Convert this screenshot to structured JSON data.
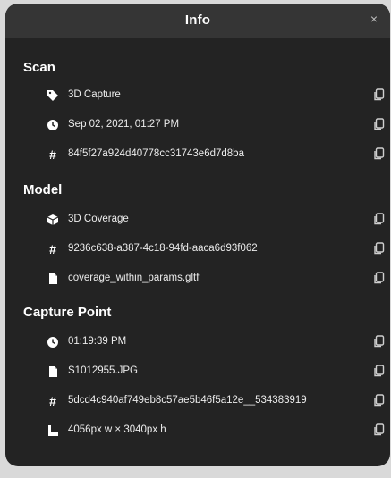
{
  "title": "Info",
  "close_glyph": "×",
  "sections": {
    "scan": {
      "title": "Scan",
      "rows": [
        {
          "icon": "tag-icon",
          "value": "3D Capture"
        },
        {
          "icon": "clock-icon",
          "value": "Sep 02, 2021, 01:27 PM"
        },
        {
          "icon": "hash-icon",
          "value": "84f5f27a924d40778cc31743e6d7d8ba"
        }
      ]
    },
    "model": {
      "title": "Model",
      "rows": [
        {
          "icon": "cube-icon",
          "value": "3D Coverage"
        },
        {
          "icon": "hash-icon",
          "value": "9236c638-a387-4c18-94fd-aaca6d93f062"
        },
        {
          "icon": "file-icon",
          "value": "coverage_within_params.gltf"
        }
      ]
    },
    "capture_point": {
      "title": "Capture Point",
      "rows": [
        {
          "icon": "clock-icon",
          "value": "01:19:39 PM"
        },
        {
          "icon": "file-icon",
          "value": "S1012955.JPG"
        },
        {
          "icon": "hash-icon",
          "value": "5dcd4c940af749eb8c57ae5b46f5a12e__534383919"
        },
        {
          "icon": "dimensions-icon",
          "value": "4056px w × 3040px h"
        }
      ]
    }
  },
  "hash_glyph": "#",
  "copy_icon": "copy-icon"
}
